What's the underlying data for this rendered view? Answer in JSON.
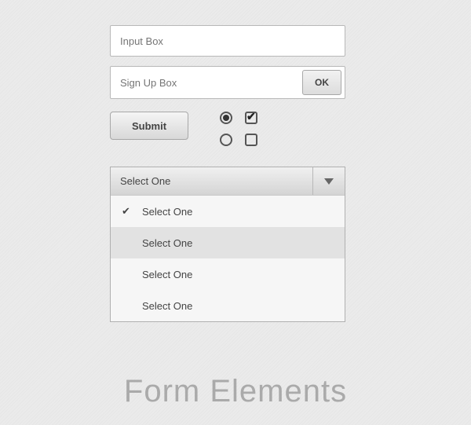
{
  "input": {
    "placeholder": "Input Box"
  },
  "signup": {
    "placeholder": "Sign Up Box",
    "ok_label": "OK"
  },
  "submit": {
    "label": "Submit"
  },
  "toggles": {
    "radio_checked": true,
    "radio_unchecked": false,
    "checkbox_checked": true,
    "checkbox_unchecked": false
  },
  "select": {
    "label": "Select One",
    "options": [
      {
        "label": "Select One",
        "selected": true,
        "hover": false
      },
      {
        "label": "Select One",
        "selected": false,
        "hover": true
      },
      {
        "label": "Select One",
        "selected": false,
        "hover": false
      },
      {
        "label": "Select One",
        "selected": false,
        "hover": false
      }
    ]
  },
  "title": "Form Elements"
}
